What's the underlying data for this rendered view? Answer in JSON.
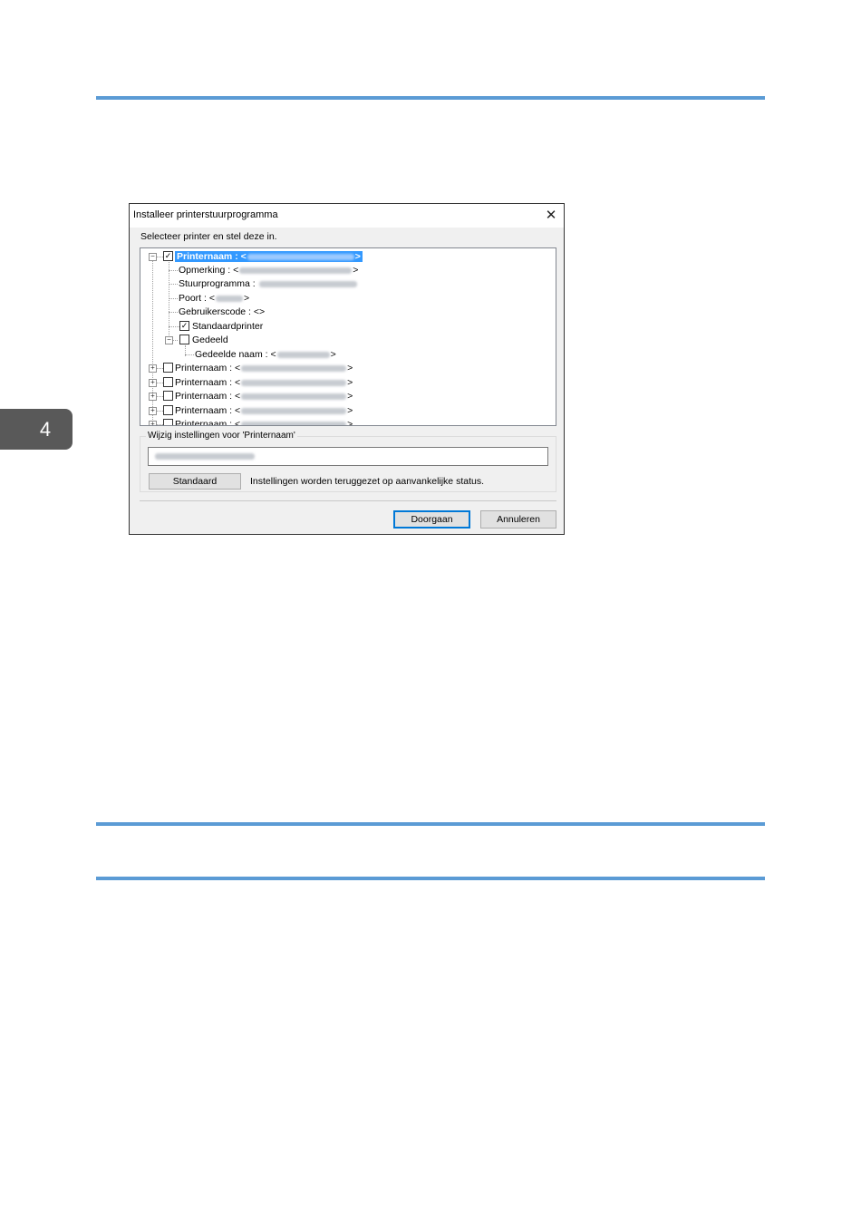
{
  "chapter_tab": "4",
  "dialog": {
    "title": "Installeer printerstuurprogramma",
    "instruction": "Selecteer printer en stel deze in.",
    "tree": {
      "selected_node": {
        "label": "Printernaam : <",
        "suffix": ">",
        "checked": true
      },
      "children": {
        "opmerking": {
          "label": "Opmerking : <",
          "suffix": ">"
        },
        "stuurprogramma": {
          "label": "Stuurprogramma : "
        },
        "poort": {
          "label": "Poort : <",
          "suffix": ">"
        },
        "gebruikerscode": {
          "label": "Gebruikerscode : <>"
        },
        "standaardprinter": {
          "label": "Standaardprinter",
          "checked": true
        },
        "gedeeld": {
          "label": "Gedeeld",
          "checked": false
        },
        "gedeelde_naam": {
          "label": "Gedeelde naam : <",
          "suffix": ">"
        }
      },
      "other_printers": [
        {
          "label": "Printernaam : <",
          "suffix": ">"
        },
        {
          "label": "Printernaam : <",
          "suffix": ">"
        },
        {
          "label": "Printernaam : <",
          "suffix": ">"
        },
        {
          "label": "Printernaam : <",
          "suffix": ">"
        },
        {
          "label": "Printernaam : <",
          "suffix": ">"
        }
      ]
    },
    "settings_group": {
      "label": "Wijzig instellingen voor 'Printernaam'",
      "standard_button": "Standaard",
      "reset_note": "Instellingen worden teruggezet op aanvankelijke status."
    },
    "buttons": {
      "continue": "Doorgaan",
      "cancel": "Annuleren"
    },
    "close_icon": "close-icon"
  },
  "colors": {
    "accent_rule": "#5b9bd5",
    "selection": "#3399ff",
    "tab": "#595959"
  }
}
